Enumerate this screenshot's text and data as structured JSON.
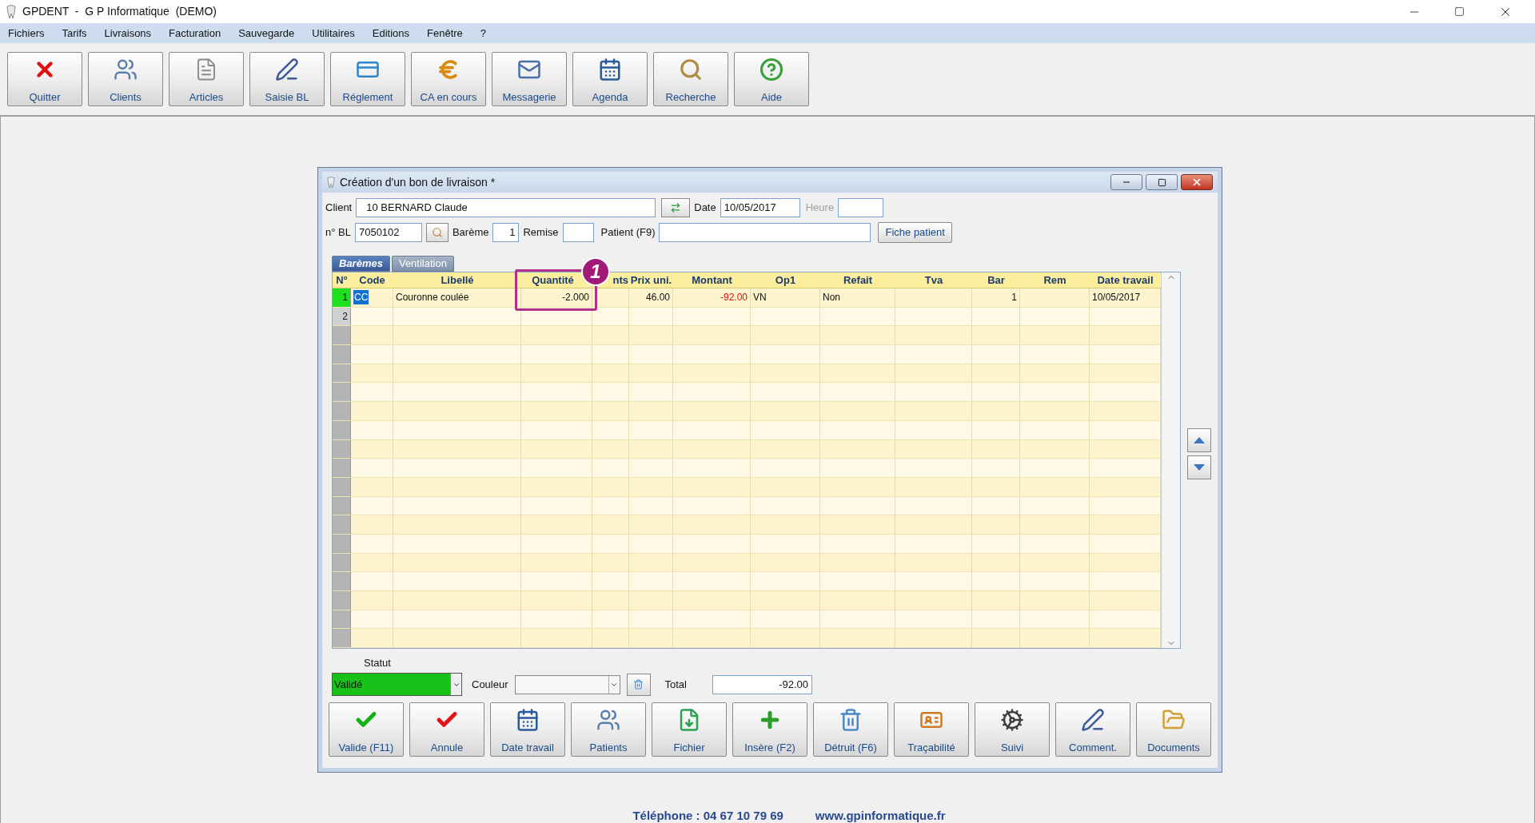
{
  "app_title": "GPDENT  -  G P Informatique  (DEMO)",
  "menu": [
    "Fichiers",
    "Tarifs",
    "Livraisons",
    "Facturation",
    "Sauvegarde",
    "Utilitaires",
    "Editions",
    "Fenêtre",
    "?"
  ],
  "toolbar": [
    {
      "label": "Quitter",
      "kind": "quit"
    },
    {
      "label": "Clients",
      "kind": "people"
    },
    {
      "label": "Articles",
      "kind": "document"
    },
    {
      "label": "Saisie BL",
      "kind": "pen"
    },
    {
      "label": "Réglement",
      "kind": "card"
    },
    {
      "label": "CA en cours",
      "kind": "euro"
    },
    {
      "label": "Messagerie",
      "kind": "mail"
    },
    {
      "label": "Agenda",
      "kind": "calendar"
    },
    {
      "label": "Recherche",
      "kind": "search"
    },
    {
      "label": "Aide",
      "kind": "help"
    }
  ],
  "dialog": {
    "title": "Création d'un bon de livraison *",
    "client": {
      "label": "Client",
      "value": "10  BERNARD Claude"
    },
    "date": {
      "label": "Date",
      "value": "10/05/2017"
    },
    "heure": {
      "label": "Heure",
      "disabled": true
    },
    "bl": {
      "label": "n° BL",
      "value": "7050102"
    },
    "bareme": {
      "label": "Barème",
      "value": "1"
    },
    "remise": {
      "label": "Remise"
    },
    "patient": {
      "label": "Patient (F9)"
    },
    "fiche_button": "Fiche patient",
    "tabs": [
      {
        "label": "Barèmes",
        "selected": true
      },
      {
        "label": "Ventilation",
        "selected": false
      }
    ],
    "grid": {
      "columns": [
        "N°",
        "Code",
        "Libellé",
        "Quantité",
        "nts",
        "Prix uni.",
        "Montant",
        "Op1",
        "Refait",
        "Tva",
        "Bar",
        "Rem",
        "Date travail"
      ],
      "rows": [
        {
          "selected": true,
          "negative_amount": true,
          "cells": [
            "1",
            "CC",
            "Couronne coulée",
            "-2.000",
            null,
            "46.00",
            "-92.00",
            "VN",
            "Non",
            null,
            "1",
            null,
            "10/05/2017"
          ]
        },
        {
          "selected": false,
          "cells": [
            "2"
          ]
        }
      ]
    },
    "annotation": {
      "label": "1"
    },
    "statut": {
      "label": "Statut",
      "value": "Validé",
      "color": "#19c219"
    },
    "couleur": {
      "label": "Couleur"
    },
    "total": {
      "label": "Total",
      "value": "-92.00"
    },
    "buttons": [
      {
        "label": "Valide (F11)",
        "kind": "check_green"
      },
      {
        "label": "Annule",
        "kind": "check_red"
      },
      {
        "label": "Date travail",
        "kind": "calendar"
      },
      {
        "label": "Patients",
        "kind": "people"
      },
      {
        "label": "Fichier",
        "kind": "import"
      },
      {
        "label": "Insère (F2)",
        "kind": "plus"
      },
      {
        "label": "Détruit (F6)",
        "kind": "trash"
      },
      {
        "label": "Traçabilité",
        "kind": "idcard"
      },
      {
        "label": "Suivi",
        "kind": "gears"
      },
      {
        "label": "Comment.",
        "kind": "pen"
      },
      {
        "label": "Documents",
        "kind": "folder"
      }
    ]
  },
  "footer": {
    "phone": "Téléphone : 04 67 10 79 69",
    "website": "www.gpinformatique.fr"
  }
}
